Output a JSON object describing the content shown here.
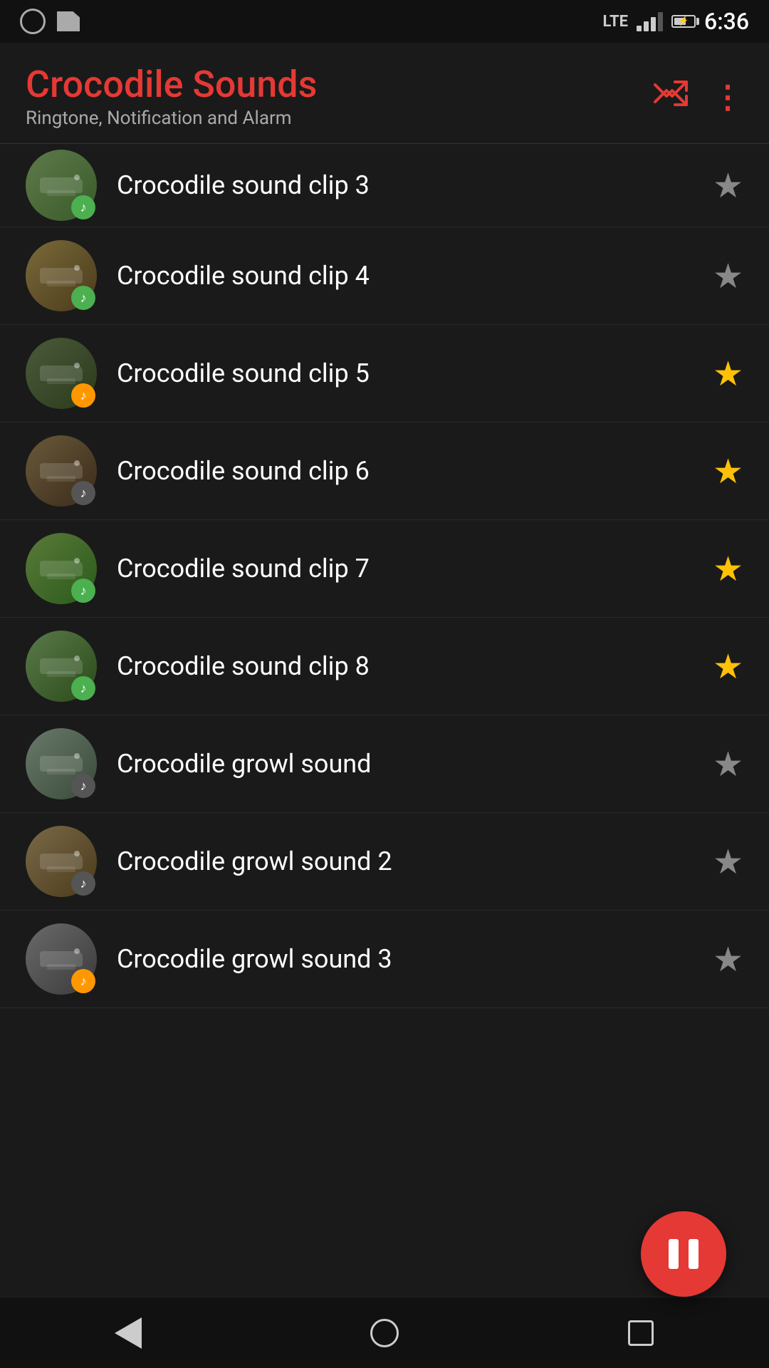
{
  "statusBar": {
    "time": "6:36",
    "lteBadge": "LTE"
  },
  "header": {
    "title": "Crocodile Sounds",
    "subtitle": "Ringtone, Notification and Alarm"
  },
  "soundList": {
    "items": [
      {
        "id": 0,
        "name": "Crocodile sound clip 3",
        "partial": true,
        "colorClass": "color-1",
        "badgeColor": "green",
        "starred": false,
        "starFilled": false
      },
      {
        "id": 1,
        "name": "Crocodile sound clip 4",
        "colorClass": "color-2",
        "badgeColor": "green",
        "starred": false,
        "starFilled": false
      },
      {
        "id": 2,
        "name": "Crocodile sound clip 5",
        "colorClass": "color-3",
        "badgeColor": "orange",
        "starred": true,
        "starFilled": true
      },
      {
        "id": 3,
        "name": "Crocodile sound clip 6",
        "colorClass": "color-4",
        "badgeColor": "dark",
        "starred": true,
        "starFilled": true
      },
      {
        "id": 4,
        "name": "Crocodile sound clip 7",
        "colorClass": "color-5",
        "badgeColor": "green",
        "starred": true,
        "starFilled": true
      },
      {
        "id": 5,
        "name": "Crocodile sound clip 8",
        "colorClass": "color-6",
        "badgeColor": "green",
        "starred": true,
        "starFilled": true
      },
      {
        "id": 6,
        "name": "Crocodile growl sound",
        "colorClass": "color-7",
        "badgeColor": "dark",
        "starred": false,
        "starFilled": false
      },
      {
        "id": 7,
        "name": "Crocodile growl sound 2",
        "colorClass": "color-8",
        "badgeColor": "dark",
        "starred": false,
        "starFilled": false
      },
      {
        "id": 8,
        "name": "Crocodile growl sound 3",
        "colorClass": "color-9",
        "badgeColor": "orange",
        "starred": false,
        "starFilled": false
      }
    ]
  },
  "fab": {
    "label": "Pause"
  }
}
